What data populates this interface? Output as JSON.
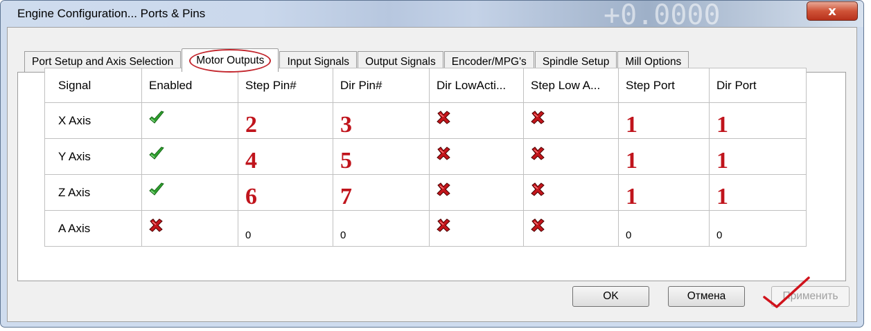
{
  "window": {
    "title": "Engine Configuration... Ports & Pins",
    "background_readout": "+0.0000",
    "close_label": "x"
  },
  "tabs": [
    {
      "label": "Port Setup and Axis Selection",
      "active": false
    },
    {
      "label": "Motor Outputs",
      "active": true
    },
    {
      "label": "Input Signals",
      "active": false
    },
    {
      "label": "Output Signals",
      "active": false
    },
    {
      "label": "Encoder/MPG's",
      "active": false
    },
    {
      "label": "Spindle Setup",
      "active": false
    },
    {
      "label": "Mill Options",
      "active": false
    }
  ],
  "table": {
    "headers": [
      "Signal",
      "Enabled",
      "Step Pin#",
      "Dir Pin#",
      "Dir LowActi...",
      "Step Low A...",
      "Step Port",
      "Dir Port"
    ],
    "rows": [
      {
        "signal": "X Axis",
        "enabled": true,
        "step_pin": "2",
        "dir_pin": "3",
        "dir_low_active": false,
        "step_low_active": false,
        "step_port": "1",
        "dir_port": "1"
      },
      {
        "signal": "Y Axis",
        "enabled": true,
        "step_pin": "4",
        "dir_pin": "5",
        "dir_low_active": false,
        "step_low_active": false,
        "step_port": "1",
        "dir_port": "1"
      },
      {
        "signal": "Z Axis",
        "enabled": true,
        "step_pin": "6",
        "dir_pin": "7",
        "dir_low_active": false,
        "step_low_active": false,
        "step_port": "1",
        "dir_port": "1"
      },
      {
        "signal": "A Axis",
        "enabled": false,
        "step_pin": "0",
        "dir_pin": "0",
        "dir_low_active": false,
        "step_low_active": false,
        "step_port": "0",
        "dir_port": "0"
      }
    ]
  },
  "buttons": {
    "ok": "OK",
    "cancel": "Отмена",
    "apply": "Применить"
  },
  "colors": {
    "annotation_red": "#c0141c",
    "check_green": "#2fa12f",
    "cross_red": "#c4161c"
  },
  "icons": {
    "enabled_true": "green-check-icon",
    "enabled_false": "red-x-icon"
  }
}
